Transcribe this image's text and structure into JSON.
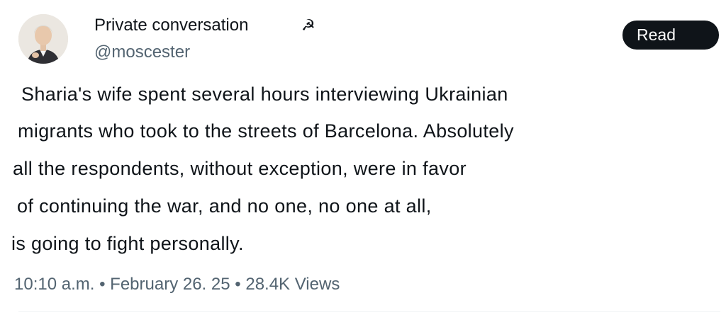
{
  "author": {
    "display_name": "Private conversation",
    "name_emoji": "☭",
    "handle": "@moscester",
    "avatar_icon": "profile-avatar-icon"
  },
  "actions": {
    "read_label": "Read"
  },
  "post": {
    "lines": [
      "Sharia's wife spent several hours interviewing Ukrainian",
      "migrants who took to the streets of Barcelona. Absolutely",
      "all the respondents, without exception, were in favor",
      "of continuing the war, and no one, no one at all,",
      "is going to fight personally."
    ]
  },
  "meta": {
    "time": "10:10 a.m.",
    "date": "February 26. 25",
    "views_count": "28.4K",
    "views_label": "Views",
    "separator": "•"
  },
  "colors": {
    "text": "#0f1419",
    "secondary": "#536471",
    "button_bg": "#0f1419",
    "button_text": "#ffffff"
  }
}
